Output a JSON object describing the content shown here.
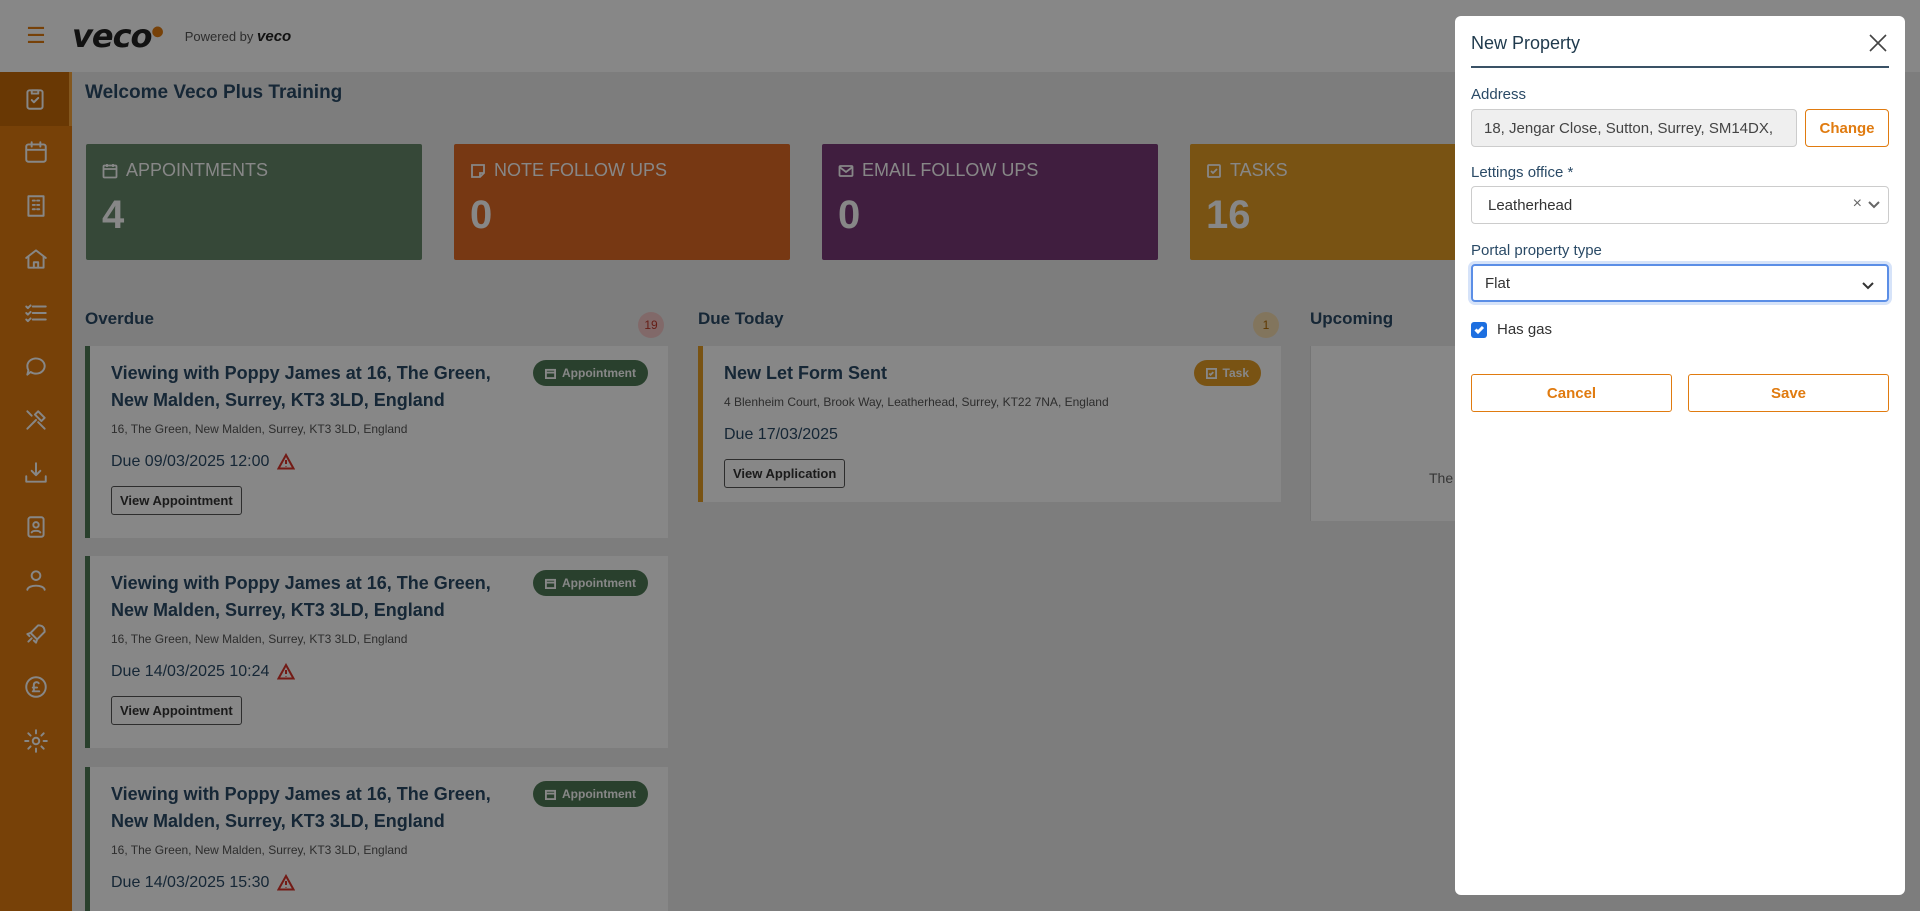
{
  "header": {
    "logo": "veco",
    "powered_by": "Powered by",
    "powered_brand": "veco"
  },
  "sidebar": {
    "icons": [
      "clipboard-check-icon",
      "calendar-icon",
      "building-icon",
      "home-icon",
      "task-list-icon",
      "chat-icon",
      "tools-icon",
      "download-tray-icon",
      "contact-card-icon",
      "person-icon",
      "rocket-icon",
      "pound-icon",
      "gear-icon"
    ]
  },
  "main": {
    "welcome": "Welcome Veco Plus Training",
    "cards": [
      {
        "label": "APPOINTMENTS",
        "value": "4",
        "color": "#66886a"
      },
      {
        "label": "NOTE FOLLOW UPS",
        "value": "0",
        "color": "#e06a25"
      },
      {
        "label": "EMAIL FOLLOW UPS",
        "value": "0",
        "color": "#7a3a78"
      },
      {
        "label": "TASKS",
        "value": "16",
        "color": "#e59d24"
      }
    ],
    "columns": {
      "overdue": {
        "title": "Overdue",
        "count": "19"
      },
      "today": {
        "title": "Due Today",
        "count": "1"
      },
      "upcoming": {
        "title": "Upcoming",
        "empty_text": "The"
      }
    },
    "overdue_items": [
      {
        "title": "Viewing with Poppy James at 16, The Green, New Malden, Surrey, KT3 3LD, England",
        "address": "16, The Green, New Malden, Surrey, KT3 3LD, England",
        "due": "Due 09/03/2025 12:00",
        "tag": "Appointment",
        "button": "View Appointment"
      },
      {
        "title": "Viewing with Poppy James at 16, The Green, New Malden, Surrey, KT3 3LD, England",
        "address": "16, The Green, New Malden, Surrey, KT3 3LD, England",
        "due": "Due 14/03/2025 10:24",
        "tag": "Appointment",
        "button": "View Appointment"
      },
      {
        "title": "Viewing with Poppy James at 16, The Green, New Malden, Surrey, KT3 3LD, England",
        "address": "16, The Green, New Malden, Surrey, KT3 3LD, England",
        "due": "Due 14/03/2025 15:30",
        "tag": "Appointment",
        "button": "View Appointment"
      }
    ],
    "today_items": [
      {
        "title": "New Let Form Sent",
        "address": "4 Blenheim Court, Brook Way, Leatherhead, Surrey, KT22 7NA, England",
        "due": "Due 17/03/2025",
        "tag": "Task",
        "button": "View Application"
      }
    ]
  },
  "modal": {
    "title": "New Property",
    "address_label": "Address",
    "address_value": "18, Jengar Close, Sutton, Surrey, SM14DX,",
    "change_label": "Change",
    "office_label": "Lettings office *",
    "office_value": "Leatherhead",
    "ptype_label": "Portal property type",
    "ptype_value": "Flat",
    "has_gas_label": "Has gas",
    "has_gas_checked": true,
    "cancel_label": "Cancel",
    "save_label": "Save"
  }
}
